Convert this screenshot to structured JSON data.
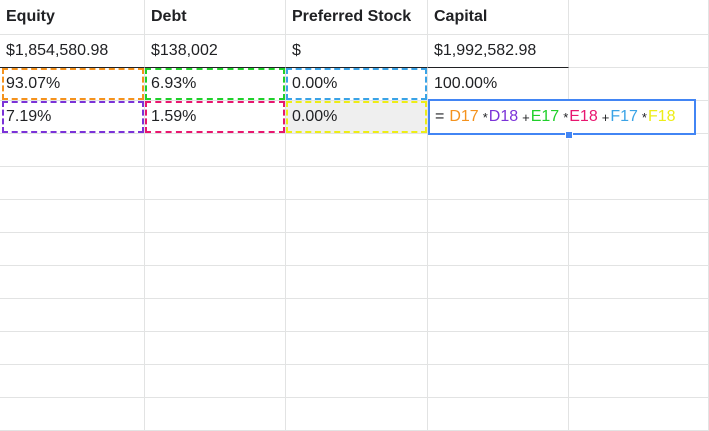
{
  "headers": {
    "equity": "Equity",
    "debt": "Debt",
    "preferred": "Preferred Stock",
    "capital": "Capital"
  },
  "values_row": {
    "equity": "$1,854,580.98",
    "debt": "$138,002",
    "preferred": "$",
    "capital": "$1,992,582.98"
  },
  "weights_row": {
    "equity": "93.07%",
    "debt": "6.93%",
    "preferred": "0.00%",
    "capital": "100.00%"
  },
  "cost_row": {
    "equity": "7.19%",
    "debt": "1.59%",
    "preferred": "0.00%"
  },
  "formula": {
    "eq": "=",
    "ref1": "D17",
    "mul1": "*",
    "ref2": "D18",
    "plus1": "+",
    "ref3": "E17",
    "mul2": "*",
    "ref4": "E18",
    "plus2": "+",
    "ref5": "F17",
    "mul3": "*",
    "ref6": "F18"
  },
  "ref_colors": {
    "D17": "#f4921d",
    "D18": "#7b32d8",
    "E17": "#1fd02a",
    "E18": "#e8166f",
    "F17": "#3aa3e6",
    "F18": "#eded17",
    "editor_border": "#4285f4"
  }
}
